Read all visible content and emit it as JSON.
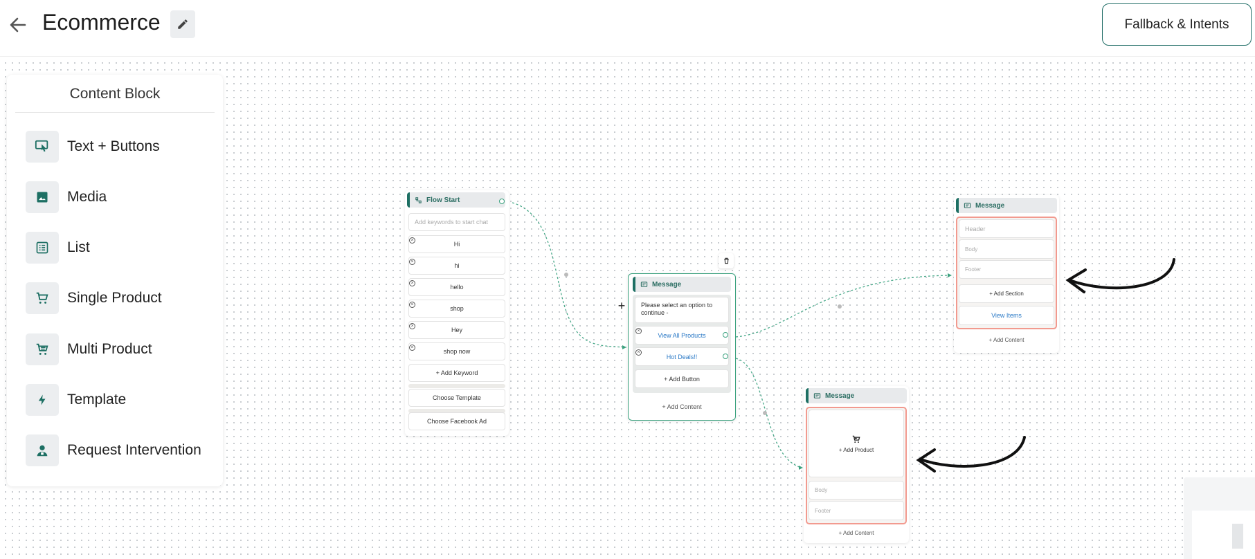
{
  "header": {
    "title": "Ecommerce",
    "fallback_button": "Fallback & Intents"
  },
  "palette": {
    "title": "Content Block",
    "items": [
      {
        "label": "Text + Buttons",
        "icon": "touch-screen-icon"
      },
      {
        "label": "Media",
        "icon": "image-icon"
      },
      {
        "label": "List",
        "icon": "list-icon"
      },
      {
        "label": "Single Product",
        "icon": "cart-icon"
      },
      {
        "label": "Multi Product",
        "icon": "multi-cart-icon"
      },
      {
        "label": "Template",
        "icon": "bolt-icon"
      },
      {
        "label": "Request Intervention",
        "icon": "agent-icon"
      }
    ]
  },
  "flow_start": {
    "title": "Flow Start",
    "keyword_placeholder": "Add keywords to start chat",
    "keywords": [
      "Hi",
      "hi",
      "hello",
      "shop",
      "Hey",
      "shop now"
    ],
    "add_keyword": "+ Add Keyword",
    "choose_template": "Choose Template",
    "choose_facebook_ad": "Choose Facebook Ad"
  },
  "message_buttons": {
    "title": "Message",
    "text": "Please select an option to continue -",
    "buttons": [
      "View All Products",
      "Hot Deals!!"
    ],
    "add_button": "+ Add Button",
    "add_content": "+ Add Content"
  },
  "message_list": {
    "title": "Message",
    "header_placeholder": "Header",
    "body_placeholder": "Body",
    "footer_placeholder": "Footer",
    "add_section": "+ Add Section",
    "view_items": "View Items",
    "add_content": "+ Add Content"
  },
  "message_product": {
    "title": "Message",
    "add_product": "+ Add Product",
    "body_placeholder": "Body",
    "footer_placeholder": "Footer",
    "add_content": "+ Add Content"
  },
  "colors": {
    "accent": "#1d6f63",
    "edge": "#4aa98a",
    "highlight": "#f29a8f"
  }
}
